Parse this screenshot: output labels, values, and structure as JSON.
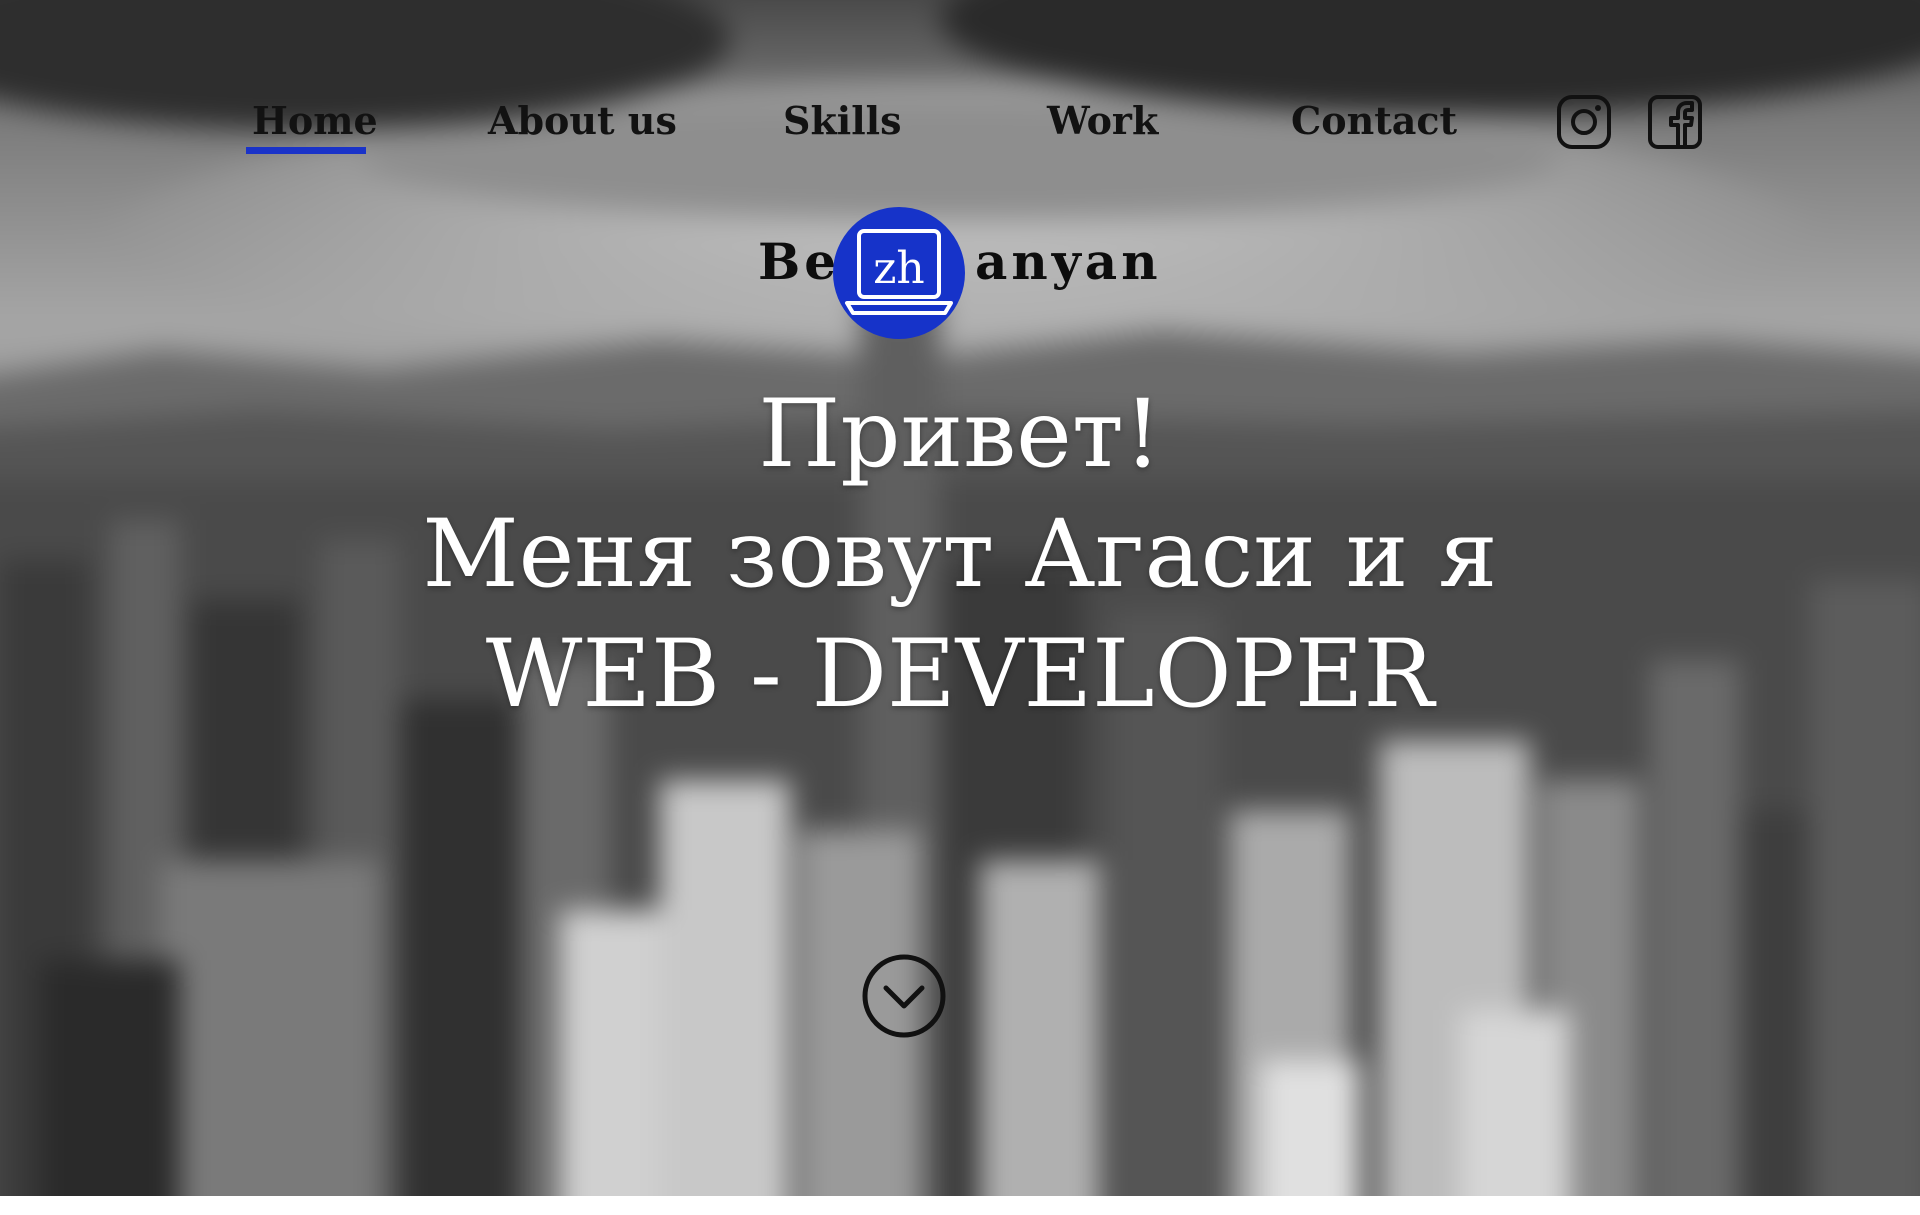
{
  "nav": {
    "items": [
      {
        "label": "Home",
        "active": true
      },
      {
        "label": "About us",
        "active": false
      },
      {
        "label": "Skills",
        "active": false
      },
      {
        "label": "Work",
        "active": false
      },
      {
        "label": "Contact",
        "active": false
      }
    ],
    "active_color": "#1a33c8",
    "social": [
      {
        "icon": "instagram-icon"
      },
      {
        "icon": "facebook-icon"
      }
    ]
  },
  "logo": {
    "prefix": "Be",
    "badge_text": "zh",
    "suffix": "anyan",
    "badge_color": "#1633c9",
    "badge_icon": "laptop-icon"
  },
  "hero": {
    "line1": "Привет!",
    "line2": "Меня зовут Агаси и я",
    "line3": "WEB - DEVELOPER",
    "scroll_icon": "chevron-down-circle-icon"
  }
}
